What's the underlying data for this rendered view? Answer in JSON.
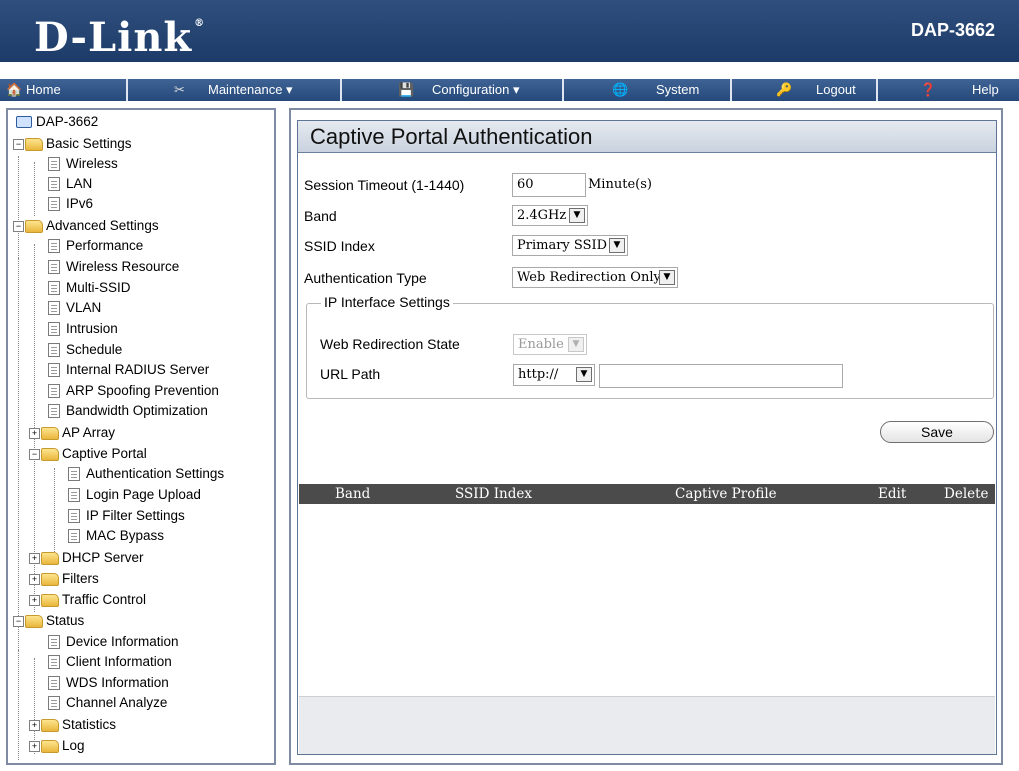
{
  "brand": {
    "logo": "D-Link",
    "reg": "®",
    "model": "DAP-3662"
  },
  "nav": [
    {
      "label": "Home",
      "icon": "home-icon",
      "glyph": "🏠"
    },
    {
      "label": "Maintenance ▾",
      "icon": "tools-icon",
      "glyph": "✂"
    },
    {
      "label": "Configuration ▾",
      "icon": "save-disk-icon",
      "glyph": "💾"
    },
    {
      "label": "System",
      "icon": "globe-icon",
      "glyph": "🌐"
    },
    {
      "label": "Logout",
      "icon": "key-icon",
      "glyph": "🔑"
    },
    {
      "label": "Help",
      "icon": "help-icon",
      "glyph": "❓"
    }
  ],
  "tree": {
    "root": "DAP-3662",
    "basic": "Basic Settings",
    "basic_items": [
      "Wireless",
      "LAN",
      "IPv6"
    ],
    "advanced": "Advanced Settings",
    "advanced_items": [
      "Performance",
      "Wireless Resource",
      "Multi-SSID",
      "VLAN",
      "Intrusion",
      "Schedule",
      "Internal RADIUS Server",
      "ARP Spoofing Prevention",
      "Bandwidth Optimization"
    ],
    "ap_array": "AP Array",
    "captive_portal": "Captive Portal",
    "captive_items": [
      "Authentication Settings",
      "Login Page Upload",
      "IP Filter Settings",
      "MAC Bypass"
    ],
    "dhcp": "DHCP Server",
    "filters": "Filters",
    "traffic": "Traffic Control",
    "status": "Status",
    "status_items": [
      "Device Information",
      "Client Information",
      "WDS Information",
      "Channel Analyze"
    ],
    "statistics": "Statistics",
    "log": "Log"
  },
  "page": {
    "title": "Captive Portal Authentication",
    "session_timeout_label": "Session Timeout (1-1440)",
    "session_timeout_value": "60",
    "session_timeout_unit": "Minute(s)",
    "band_label": "Band",
    "band_value": "2.4GHz",
    "ssid_label": "SSID Index",
    "ssid_value": "Primary SSID",
    "auth_type_label": "Authentication Type",
    "auth_type_value": "Web Redirection Only",
    "ip_group_legend": "IP Interface Settings",
    "web_redirect_label": "Web Redirection State",
    "web_redirect_value": "Enable",
    "url_path_label": "URL Path",
    "url_protocol_value": "http://",
    "url_path_value": "",
    "save_label": "Save"
  },
  "table": {
    "headers": [
      "Band",
      "SSID Index",
      "Captive Profile",
      "Edit",
      "Delete"
    ]
  }
}
